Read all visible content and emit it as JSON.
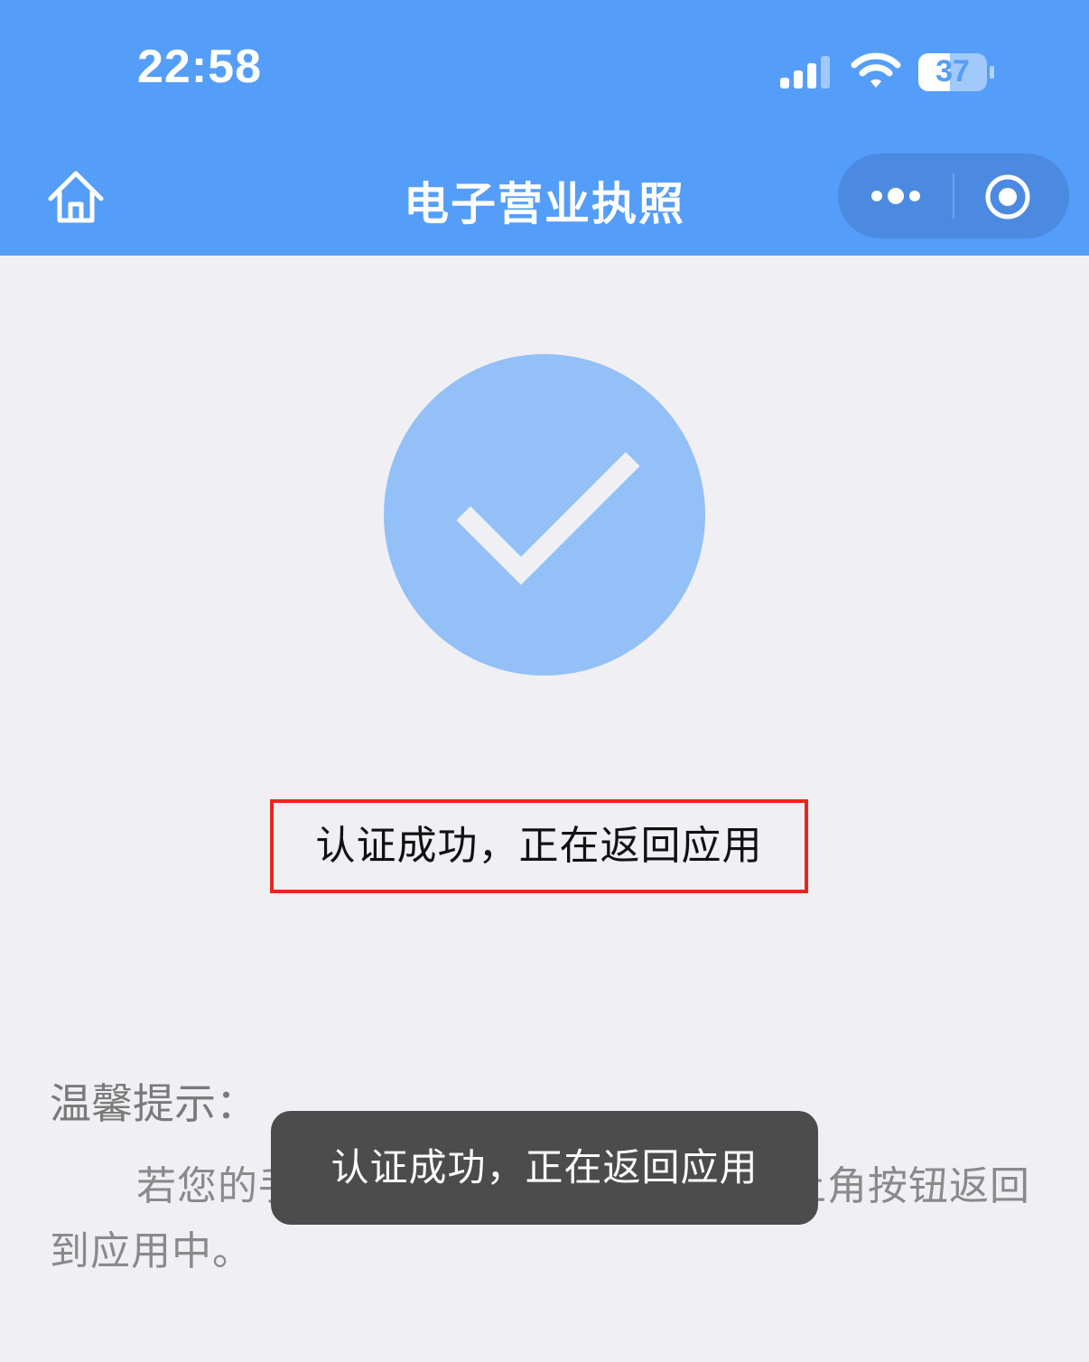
{
  "status_bar": {
    "time": "22:58",
    "battery_level": "37",
    "signal_icon": "signal-bars-icon",
    "wifi_icon": "wifi-icon",
    "battery_icon": "battery-icon"
  },
  "nav": {
    "title": "电子营业执照",
    "home_icon": "home-icon",
    "more_icon": "more-dots-icon",
    "close_icon": "close-target-icon"
  },
  "result": {
    "icon": "check-circle-icon",
    "message": "认证成功，正在返回应用"
  },
  "tips": {
    "title": "温馨提示：",
    "body": "若您的手机未能自动跳转，请点击左上角按钮返回到应用中。"
  },
  "toast": {
    "message": "认证成功，正在返回应用"
  },
  "colors": {
    "header_bg": "#549df9",
    "page_bg": "#f0eff4",
    "check_circle": "#93c1f7",
    "highlight_border": "#e8261b",
    "toast_bg": "#4c4c4c"
  }
}
